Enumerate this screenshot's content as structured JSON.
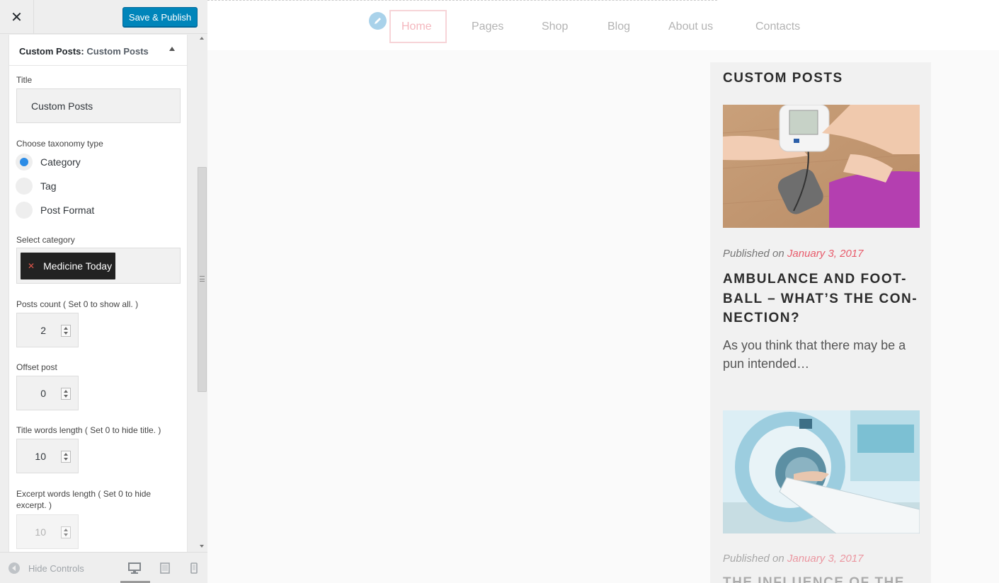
{
  "header": {
    "close_glyph": "✕",
    "publish_label": "Save & Publish"
  },
  "widget": {
    "type_label": "Custom Posts:",
    "instance_label": "Custom Posts",
    "title_label": "Title",
    "title_value": "Custom Posts",
    "taxonomy_label": "Choose taxonomy type",
    "taxonomy_options": [
      {
        "label": "Category",
        "checked": true
      },
      {
        "label": "Tag",
        "checked": false
      },
      {
        "label": "Post Format",
        "checked": false
      }
    ],
    "category_label": "Select category",
    "category_chip": "Medicine Today",
    "posts_count_label": "Posts count ( Set 0 to show all. )",
    "posts_count_value": "2",
    "offset_label": "Offset post",
    "offset_value": "0",
    "title_words_label": "Title words length ( Set 0 to hide title. )",
    "title_words_value": "10",
    "excerpt_words_label": "Excerpt words length ( Set 0 to hide excerpt. )",
    "excerpt_words_value": "10"
  },
  "footer": {
    "hide_controls_label": "Hide Controls",
    "devices": [
      "desktop-icon",
      "tablet-icon",
      "mobile-icon"
    ]
  },
  "preview": {
    "nav": [
      "Home",
      "Pages",
      "Shop",
      "Blog",
      "About us",
      "Contacts"
    ],
    "widget_title": "CUSTOM POSTS",
    "posts": [
      {
        "meta_prefix": "Published on ",
        "date": "January 3, 2017",
        "title": "AMBULANCE AND FOOT-BALL – WHAT’S THE CON-NECTION?",
        "excerpt": "As you think that there may be a pun intended…"
      },
      {
        "meta_prefix": "Published on ",
        "date": "January 3, 2017",
        "title": "THE INFLUENCE OF THE"
      }
    ]
  },
  "colors": {
    "publish": "#0085ba",
    "radio_checked": "#2c8ce6",
    "accent_date": "#e85b6b",
    "nav_active": "#f4b7be"
  }
}
